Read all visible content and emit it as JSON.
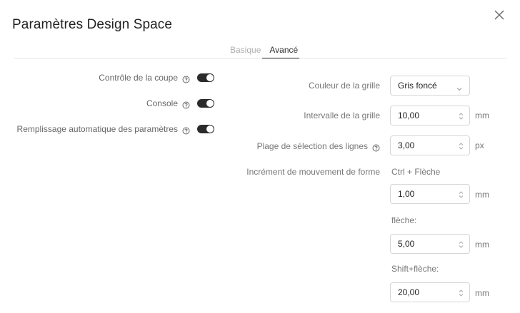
{
  "dialog": {
    "title": "Paramètres Design Space",
    "close_icon": "close-icon"
  },
  "tabs": [
    {
      "label": "Basique",
      "active": false
    },
    {
      "label": "Avancé",
      "active": true
    }
  ],
  "left": {
    "items": [
      {
        "label": "Contrôle de la coupe",
        "enabled": true
      },
      {
        "label": "Console",
        "enabled": true
      },
      {
        "label": "Remplissage automatique des paramètres",
        "enabled": true
      }
    ]
  },
  "right": {
    "grid_color": {
      "label": "Couleur de la grille",
      "value": "Gris foncé"
    },
    "grid_interval": {
      "label": "Intervalle de la grille",
      "value": "10,00",
      "unit": "mm"
    },
    "line_select": {
      "label": "Plage de sélection des lignes",
      "value": "3,00",
      "unit": "px"
    },
    "shape_move": {
      "label": "Incrément de mouvement de forme",
      "ctrl_label": "Ctrl + Flèche",
      "ctrl_value": "1,00",
      "ctrl_unit": "mm",
      "arrow_label": "flèche:",
      "arrow_value": "5,00",
      "arrow_unit": "mm",
      "shift_label": "Shift+flèche:",
      "shift_value": "20,00",
      "shift_unit": "mm"
    }
  },
  "colors": {
    "toggle_on": "#2b2b2b",
    "border": "#d6d6d6",
    "title": "#222222"
  }
}
